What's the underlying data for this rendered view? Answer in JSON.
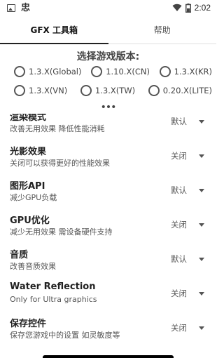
{
  "status_bar": {
    "app_glyph": "忠",
    "time": "2:02",
    "icons": [
      "image-icon",
      "wifi-icon",
      "battery-icon"
    ]
  },
  "tabs": [
    {
      "label": "GFX 工具箱",
      "active": true
    },
    {
      "label": "帮助",
      "active": false
    }
  ],
  "version": {
    "title": "选择游戏版本:",
    "options": [
      "1.3.X(Global)",
      "1.10.X(CN)",
      "1.3.X(KR)",
      "1.3.X(VN)",
      "1.3.X(TW)",
      "0.20.X(LITE)"
    ]
  },
  "more_indicator": "•••",
  "settings": [
    {
      "title": "渲染模式",
      "desc": "改善无用效果 降低性能消耗",
      "value": "默认"
    },
    {
      "title": "光影效果",
      "desc": "关闭可以获得更好的性能效果",
      "value": "关闭"
    },
    {
      "title": "图形API",
      "desc": "减少GPU负载",
      "value": "默认"
    },
    {
      "title": "GPU优化",
      "desc": "减少无用效果 需设备硬件支持",
      "value": "关闭"
    },
    {
      "title": "音质",
      "desc": "改善音质效果",
      "value": "默认"
    },
    {
      "title": "Water Reflection",
      "desc": "Only for Ultra graphics",
      "value": "关闭"
    },
    {
      "title": "保存控件",
      "desc": "保存您游戏中的设置 如灵敏度等",
      "value": "关闭"
    }
  ]
}
